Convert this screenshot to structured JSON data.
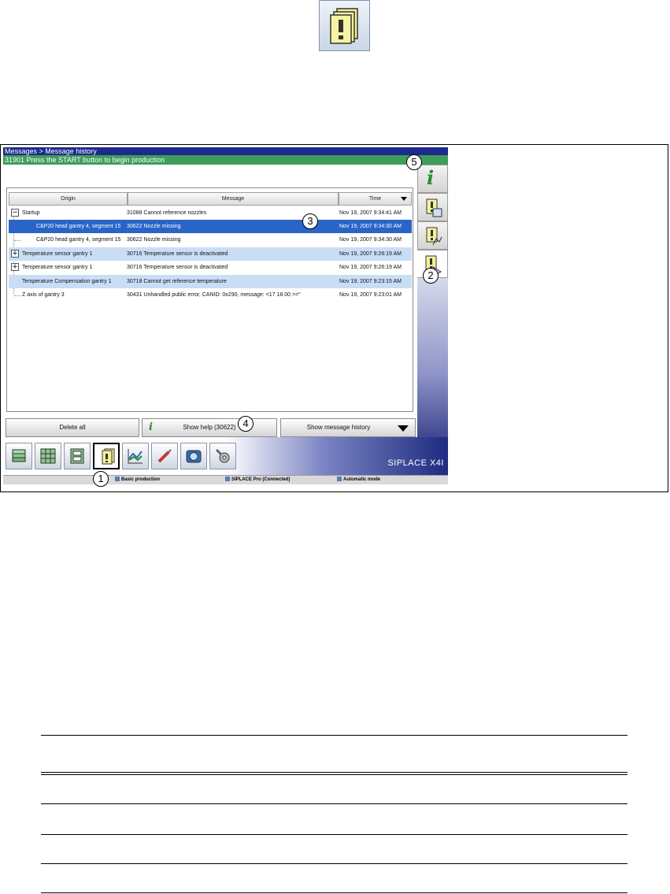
{
  "window": {
    "breadcrumb": "Messages > Message history",
    "status_message": "31901 Press the START button to begin production"
  },
  "table": {
    "columns": [
      "Origin",
      "Message",
      "Time"
    ],
    "rows": [
      {
        "origin": "Startup",
        "message": "31088 Cannot reference nozzles",
        "time": "Nov 19, 2007 9:34:41 AM",
        "expander": "−"
      },
      {
        "origin": "C&P20 head gantry 4, segment 15",
        "message": "30622 Nozzle missing",
        "time": "Nov 19, 2007 9:34:30 AM",
        "expander": ""
      },
      {
        "origin": "C&P20 head gantry 4, segment 15",
        "message": "30622 Nozzle missing",
        "time": "Nov 19, 2007 9:34:30 AM",
        "expander": ""
      },
      {
        "origin": "Temperature sensor gantry 1",
        "message": "30716 Temperature sensor is deactivated",
        "time": "Nov 19, 2007 9:26:19 AM",
        "expander": "+"
      },
      {
        "origin": "Temperature sensor gantry 1",
        "message": "30716 Temperature sensor is deactivated",
        "time": "Nov 19, 2007 9:26:19 AM",
        "expander": "+"
      },
      {
        "origin": "Temperature Compensation gantry 1",
        "message": "30718 Cannot get reference temperature",
        "time": "Nov 19, 2007 9:23:15 AM",
        "expander": ""
      },
      {
        "origin": "Z axis of gantry 3",
        "message": "30431 Unhandled public error, CANID: 0x290, message: <17 18 00 >=\"",
        "time": "Nov 19, 2007 9:23:01 AM",
        "expander": ""
      }
    ]
  },
  "buttons": {
    "delete_all": "Delete all",
    "show_help": "Show help (30622)",
    "show_history": "Show message history"
  },
  "brand": "SIPLACE X4I",
  "footer": {
    "mode": "Basic production",
    "connection": "SIPLACE Pro (Connected)",
    "operation": "Automatic mode"
  },
  "callouts": [
    "1",
    "2",
    "3",
    "4",
    "5"
  ],
  "toolbar_icons": [
    "component-stack-icon",
    "component-grid-icon",
    "machine-icon",
    "messages-icon",
    "statistics-icon",
    "tools-icon",
    "camera-icon",
    "settings-icon"
  ],
  "side_icons": [
    "info-icon",
    "message-display-icon",
    "message-list-icon",
    "message-history-icon"
  ],
  "colors": {
    "title_bar": "#1b2a8c",
    "status_bar": "#3e9d5a",
    "selected_row": "#2a64c6",
    "alt_row": "#c9def5"
  }
}
